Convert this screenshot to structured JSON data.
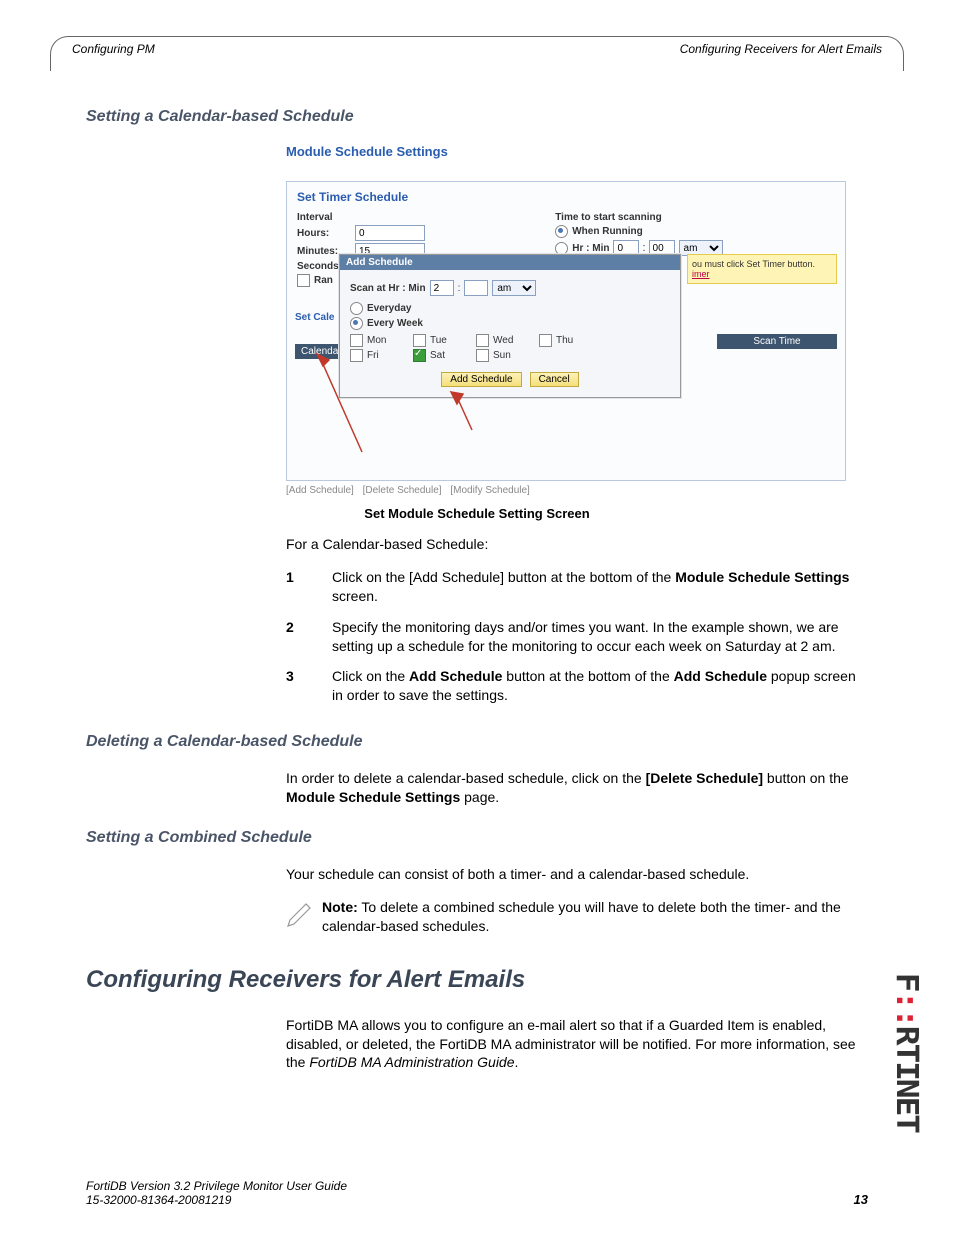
{
  "header": {
    "left": "Configuring PM",
    "right": "Configuring Receivers for Alert Emails"
  },
  "sec1_title": "Setting a Calendar-based Schedule",
  "mod_title": "Module Schedule Settings",
  "panel_title": "Set Timer Schedule",
  "labels": {
    "interval": "Interval",
    "hours": "Hours:",
    "minutes": "Minutes:",
    "seconds": "Seconds:",
    "ran": "Ran",
    "time_start": "Time to start scanning",
    "when_running": "When Running",
    "hrmin": "Hr : Min",
    "comma": ":",
    "ampm": "am",
    "scan_at": "Scan at Hr : Min",
    "everyday": "Everyday",
    "everyweek": "Every Week"
  },
  "vals": {
    "hours": "0",
    "minutes": "15",
    "hr": "0",
    "min": "00",
    "scan_hr": "2"
  },
  "days": {
    "mon": "Mon",
    "tue": "Tue",
    "wed": "Wed",
    "thu": "Thu",
    "fri": "Fri",
    "sat": "Sat",
    "sun": "Sun"
  },
  "popup": {
    "title": "Add Schedule",
    "add": "Add Schedule",
    "cancel": "Cancel"
  },
  "yellow": {
    "l1": "ou must click Set Timer button.",
    "l2": "imer"
  },
  "scan_time": "Scan Time",
  "set_cal": "Set Cale",
  "calenda": "Calenda",
  "link_bar": {
    "add": "[Add Schedule]",
    "del": "[Delete Schedule]",
    "mod": "[Modify Schedule]"
  },
  "caption": "Set Module Schedule Setting Screen",
  "intro": "For a Calendar-based Schedule:",
  "step1_a": "Click on the [Add Schedule] button at the bottom of the ",
  "step1_b": "Module Schedule Settings",
  "step1_c": " screen.",
  "step2": "Specify the monitoring days and/or times you want. In the example shown, we are setting up a schedule for the monitoring to occur each week on Saturday at 2 am.",
  "step3_a": "Click on the ",
  "step3_b": "Add Schedule",
  "step3_c": " button at the bottom of the ",
  "step3_d": "Add Schedule",
  "step3_e": " popup screen in order to save the settings.",
  "sec2_title": "Deleting a Calendar-based Schedule",
  "sec2_a": "In order to delete a calendar-based schedule, click on the ",
  "sec2_b": "[Delete Schedule]",
  "sec2_c": " button on the ",
  "sec2_d": "Module Schedule Settings",
  "sec2_e": " page.",
  "sec3_title": "Setting a Combined Schedule",
  "sec3_p": "Your schedule can consist of both a timer- and a calendar-based schedule.",
  "note_a": "Note:",
  "note_b": " To delete a combined schedule you will have to delete both the timer- and the calendar-based schedules.",
  "h2": "Configuring Receivers for Alert Emails",
  "p2_a": "FortiDB MA allows you to configure an e-mail alert so that if a Guarded Item is enabled, disabled, or deleted, the FortiDB MA administrator will be notified. For more information, see the ",
  "p2_b": "FortiDB MA Administration Guide",
  "p2_c": ".",
  "footer": {
    "l1": "FortiDB Version 3.2 Privilege Monitor  User Guide",
    "l2": "15-32000-81364-20081219",
    "pg": "13"
  },
  "logo": {
    "a": "F",
    "b": "::",
    "c": "RTINET"
  }
}
